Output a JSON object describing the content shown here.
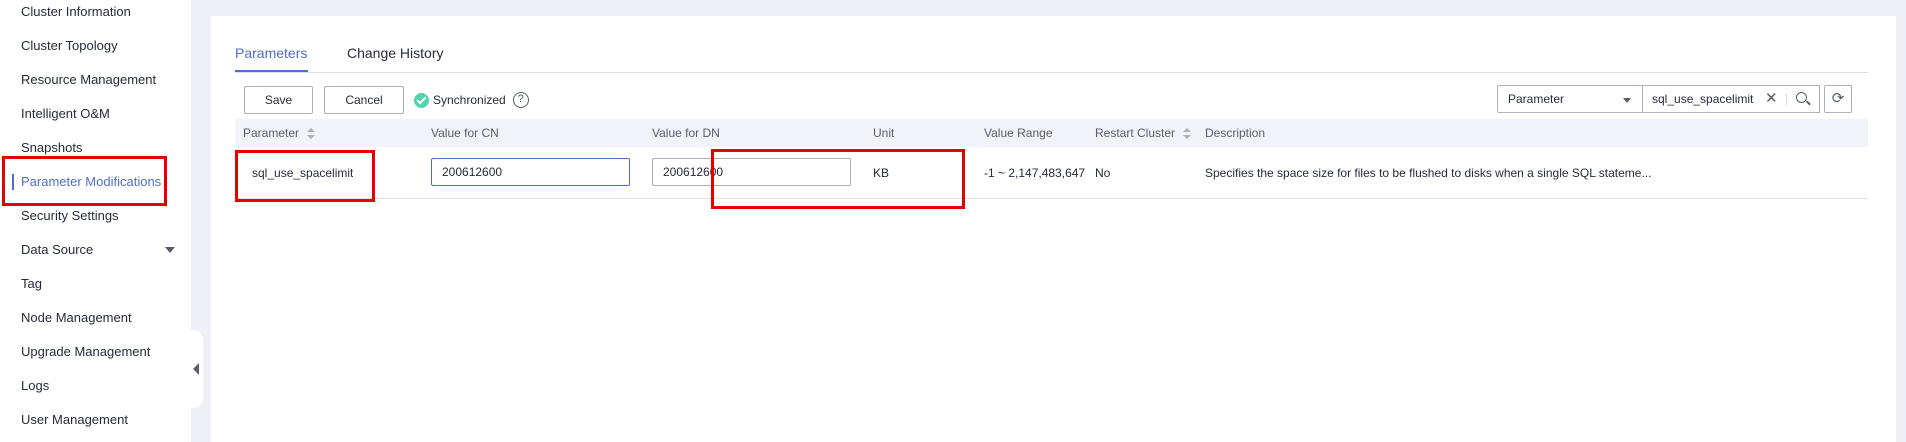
{
  "sidebar": {
    "items": [
      {
        "label": "Cluster Information"
      },
      {
        "label": "Cluster Topology"
      },
      {
        "label": "Resource Management"
      },
      {
        "label": "Intelligent O&M"
      },
      {
        "label": "Snapshots"
      },
      {
        "label": "Parameter Modifications",
        "active": true
      },
      {
        "label": "Security Settings"
      },
      {
        "label": "Data Source",
        "expandable": true
      },
      {
        "label": "Tag"
      },
      {
        "label": "Node Management"
      },
      {
        "label": "Upgrade Management"
      },
      {
        "label": "Logs"
      },
      {
        "label": "User Management"
      }
    ]
  },
  "tabs": [
    {
      "label": "Parameters",
      "active": true
    },
    {
      "label": "Change History"
    }
  ],
  "toolbar": {
    "save_label": "Save",
    "cancel_label": "Cancel",
    "sync_status": "Synchronized",
    "help_glyph": "?"
  },
  "search": {
    "field_select": "Parameter",
    "query": "sql_use_spacelimit"
  },
  "table": {
    "columns": [
      "Parameter",
      "Value for CN",
      "Value for DN",
      "Unit",
      "Value Range",
      "Restart Cluster",
      "Description"
    ],
    "rows": [
      {
        "parameter": "sql_use_spacelimit",
        "value_cn": "200612600",
        "value_dn": "200612600",
        "unit": "KB",
        "range": "-1 ~ 2,147,483,647",
        "restart": "No",
        "description": "Specifies the space size for files to be flushed to disks when a single SQL stateme..."
      }
    ]
  },
  "colors": {
    "accent": "#526ecc",
    "highlight": "#e60000",
    "sync_ok": "#50d4ab"
  }
}
